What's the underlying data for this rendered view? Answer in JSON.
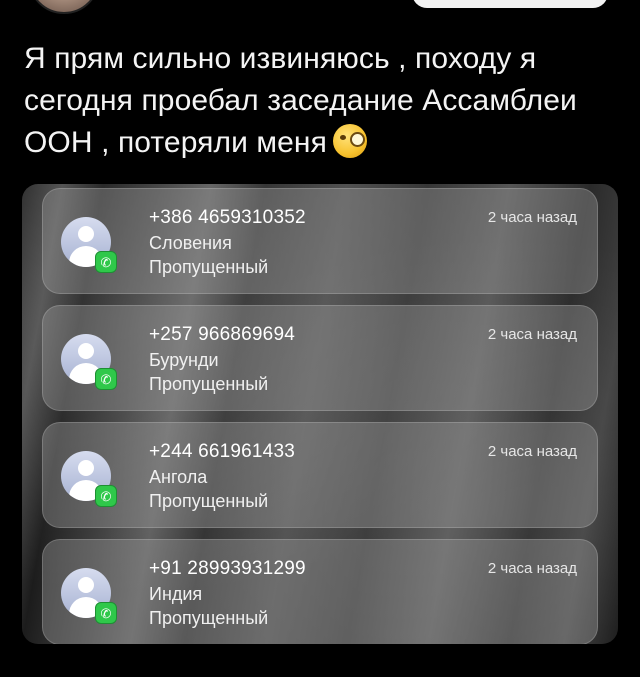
{
  "post": {
    "text": "Я прям сильно извиняюсь , походу я сегодня проебал заседание Ассамблеи ООН , потеряли меня",
    "emoji": "face-with-monocle"
  },
  "calls": [
    {
      "number": "+386 4659310352",
      "country": "Словения",
      "status": "Пропущенный",
      "time": "2 часа назад"
    },
    {
      "number": "+257 966869694",
      "country": "Бурунди",
      "status": "Пропущенный",
      "time": "2 часа назад"
    },
    {
      "number": "+244 661961433",
      "country": "Ангола",
      "status": "Пропущенный",
      "time": "2 часа назад"
    },
    {
      "number": "+91 28993931299",
      "country": "Индия",
      "status": "Пропущенный",
      "time": "2 часа назад"
    }
  ],
  "icons": {
    "contact": "contact-avatar-icon",
    "call_app": "phone-icon"
  },
  "colors": {
    "background": "#000000",
    "call_badge": "#2fc84a"
  }
}
